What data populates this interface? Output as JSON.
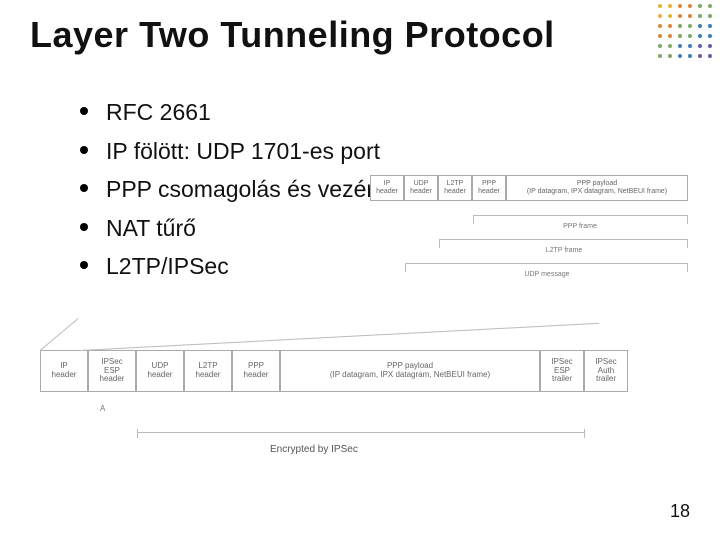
{
  "title": "Layer Two Tunneling Protocol",
  "bullets": {
    "b1": "RFC 2661",
    "b2": "IP fölött: UDP 1701-es port",
    "b3": "PPP csomagolás és vezérlés",
    "b4": "NAT tűrő",
    "b5": "L2TP/IPSec"
  },
  "page_number": "18",
  "small_diagram": {
    "boxes": {
      "ip": "IP\nheader",
      "udp": "UDP\nheader",
      "l2tp": "L2TP\nheader",
      "ppp": "PPP\nheader",
      "payload": "PPP payload\n(IP datagram, IPX datagram, NetBEUI frame)"
    },
    "dims": {
      "ppp_frame": "PPP frame",
      "l2tp_frame": "L2TP frame",
      "udp_message": "UDP message"
    }
  },
  "large_diagram": {
    "boxes": {
      "ip": "IP\nheader",
      "ipsec_esp": "IPSec\nESP\nheader",
      "udp": "UDP\nheader",
      "l2tp": "L2TP\nheader",
      "ppp": "PPP\nheader",
      "payload": "PPP payload\n(IP datagram, IPX datagram, NetBEUI frame)",
      "esp_trailer": "IPSec\nESP\ntrailer",
      "esp_auth": "IPSec\nAuth\ntrailer"
    },
    "arrow_label": "A",
    "encrypted_label": "Encrypted by IPSec"
  },
  "dot_colors": {
    "c1": "#e3b53a",
    "c2": "#d9873a",
    "c3": "#7fa86a",
    "c4": "#3f7fb7",
    "c5": "#6a5ea8"
  }
}
